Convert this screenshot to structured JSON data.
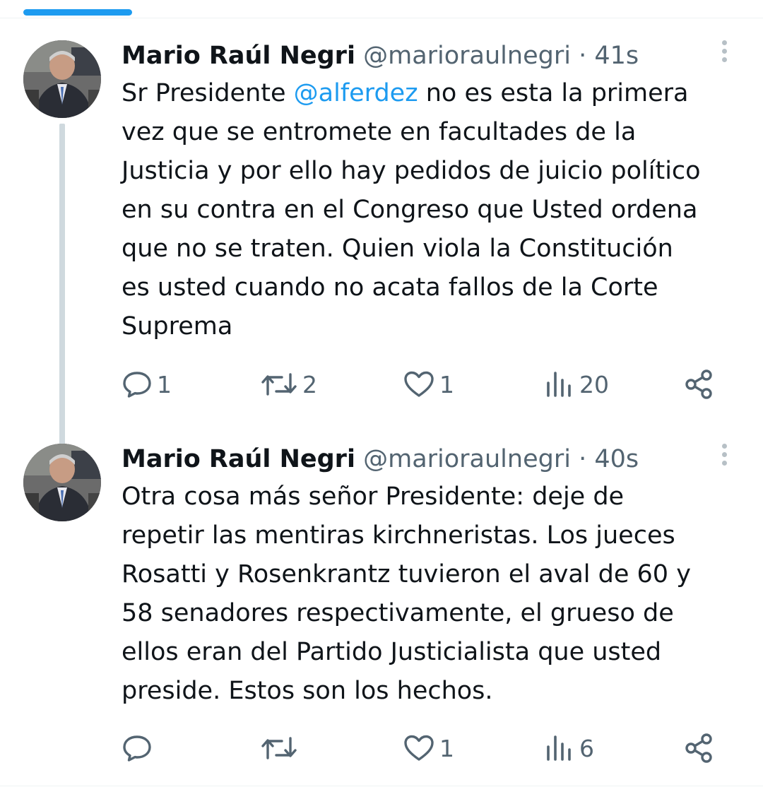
{
  "tweets": [
    {
      "author_name": "Mario Raúl Negri",
      "handle": "@marioraulnegri",
      "separator": "·",
      "time": "41s",
      "text_lines": [
        [
          "Sr Presidente ",
          "@alferdez",
          " no es esta la primera"
        ],
        "vez que se entromete en facultades de la",
        "Justicia y por ello hay pedidos de juicio político",
        "en su contra en el Congreso que Usted ordena",
        "que no se traten. Quien viola la Constitución",
        "es usted cuando no acata fallos de la Corte",
        "Suprema"
      ],
      "text_part1": "Sr Presidente ",
      "mention": "@alferdez",
      "text_part2": " no es esta la primera",
      "line2": "vez que se entromete en facultades de la",
      "line3": "Justicia y por ello hay pedidos de juicio político",
      "line4": "en su contra en el Congreso que Usted ordena",
      "line5": "que no se traten. Quien viola la Constitución",
      "line6": "es usted cuando no acata fallos de la Corte",
      "line7": "Suprema",
      "replies": "1",
      "retweets": "2",
      "likes": "1",
      "views": "20"
    },
    {
      "author_name": "Mario Raúl Negri",
      "handle": "@marioraulnegri",
      "separator": "·",
      "time": "40s",
      "line1": "Otra cosa más señor Presidente: deje de",
      "line2": "repetir las mentiras kirchneristas. Los jueces",
      "line3": "Rosatti y Rosenkrantz tuvieron el aval de 60 y",
      "line4": "58 senadores respectivamente, el grueso de",
      "line5": "ellos eran del Partido Justicialista que usted",
      "line6": "preside. Estos son los hechos.",
      "replies": "",
      "retweets": "",
      "likes": "1",
      "views": "6"
    }
  ],
  "icons": {
    "reply": "reply-icon",
    "retweet": "retweet-icon",
    "like": "heart-icon",
    "views": "views-icon",
    "share": "share-icon",
    "more": "more-vertical-icon"
  },
  "colors": {
    "link": "#1d9bf0",
    "secondary": "#536471",
    "text": "#0f1419",
    "thread_line": "#cfd9de"
  }
}
